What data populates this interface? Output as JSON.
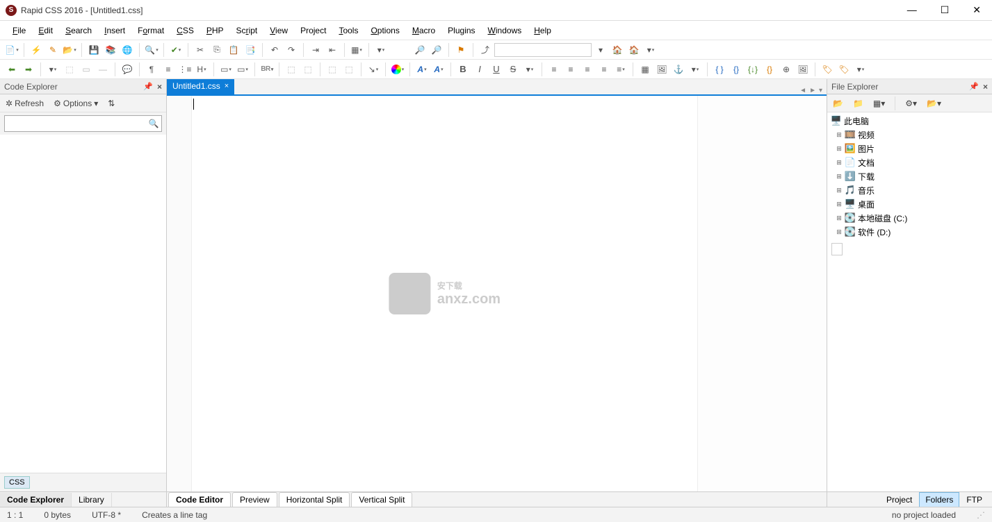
{
  "title": "Rapid CSS 2016 - [Untitled1.css]",
  "menus": [
    "File",
    "Edit",
    "Search",
    "Insert",
    "Format",
    "CSS",
    "PHP",
    "Script",
    "View",
    "Project",
    "Tools",
    "Options",
    "Macro",
    "Plugins",
    "Windows",
    "Help"
  ],
  "left_panel": {
    "title": "Code Explorer",
    "refresh": "Refresh",
    "options": "Options",
    "lang_chip": "CSS",
    "tabs": [
      "Code Explorer",
      "Library"
    ]
  },
  "right_panel": {
    "title": "File Explorer",
    "tabs": [
      "Project",
      "Folders",
      "FTP"
    ],
    "active_tab": "Folders",
    "tree": [
      {
        "icon": "🖥️",
        "label": "此电脑",
        "root": true
      },
      {
        "icon": "🎞️",
        "label": "视频"
      },
      {
        "icon": "🖼️",
        "label": "图片"
      },
      {
        "icon": "📄",
        "label": "文档"
      },
      {
        "icon": "⬇️",
        "label": "下载"
      },
      {
        "icon": "🎵",
        "label": "音乐"
      },
      {
        "icon": "🖥️",
        "label": "桌面"
      },
      {
        "icon": "💽",
        "label": "本地磁盘 (C:)"
      },
      {
        "icon": "💽",
        "label": "软件 (D:)"
      }
    ]
  },
  "editor": {
    "tab": "Untitled1.css",
    "bottom_tabs": [
      "Code Editor",
      "Preview",
      "Horizontal Split",
      "Vertical Split"
    ],
    "watermark": "安下载",
    "watermark_sub": "anxz.com"
  },
  "status": {
    "pos": "1 : 1",
    "size": "0 bytes",
    "enc": "UTF-8 *",
    "hint": "Creates a line tag",
    "project": "no project loaded"
  }
}
